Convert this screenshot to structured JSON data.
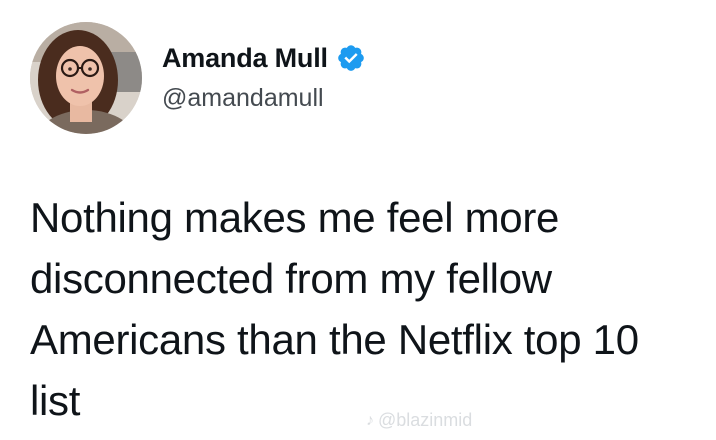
{
  "author": {
    "display_name": "Amanda Mull",
    "handle": "@amandamull",
    "verified": true
  },
  "tweet": {
    "lines": [
      "Nothing makes me feel more",
      "disconnected from my fellow",
      "Americans than the Netflix top 10",
      "list"
    ]
  },
  "watermark": {
    "text": "@blazinmid",
    "icon": "tiktok-icon"
  },
  "colors": {
    "verified_badge": "#1d9bf0",
    "text": "#0f1419",
    "handle": "#444a50"
  }
}
